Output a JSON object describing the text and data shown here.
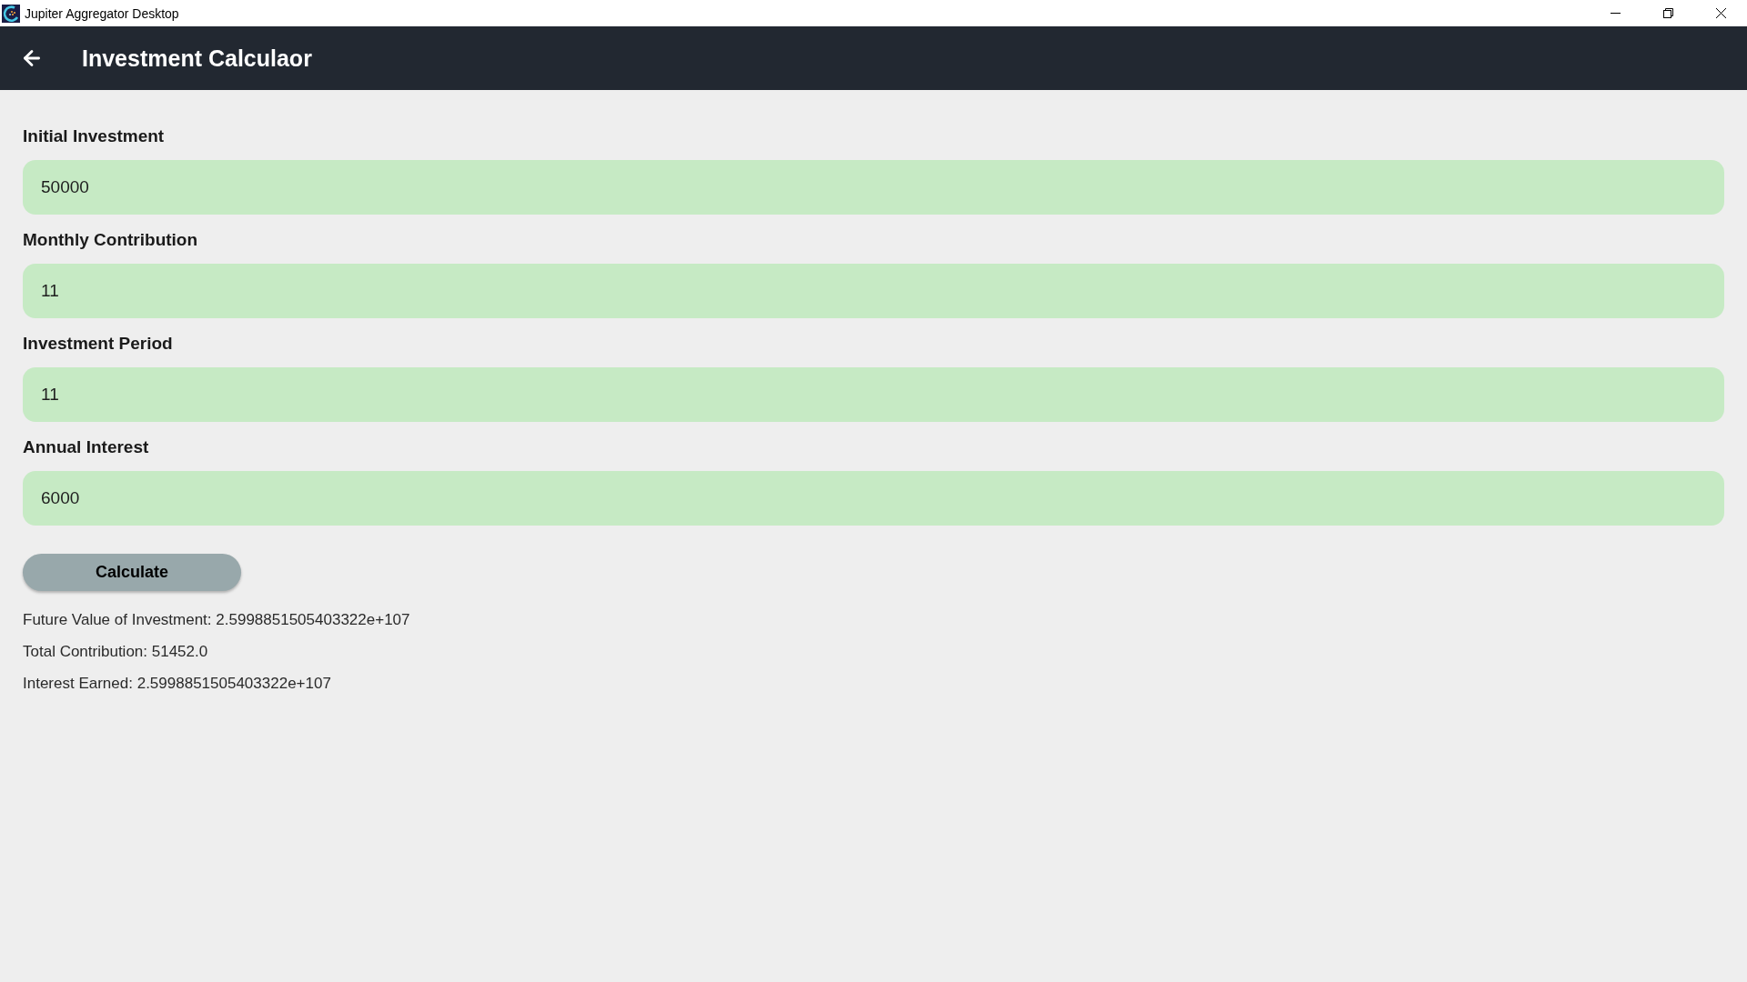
{
  "window": {
    "title": "Jupiter Aggregator Desktop"
  },
  "app_bar": {
    "title": "Investment Calculaor"
  },
  "fields": [
    {
      "label": "Initial Investment",
      "value": "50000"
    },
    {
      "label": "Monthly Contribution",
      "value": "11"
    },
    {
      "label": "Investment Period",
      "value": "11"
    },
    {
      "label": "Annual Interest",
      "value": "6000"
    }
  ],
  "calculate_button": {
    "label": "Calculate"
  },
  "results": [
    "Future Value of Investment: 2.5998851505403322e+107",
    "Total Contribution: 51452.0",
    "Interest Earned: 2.5998851505403322e+107"
  ]
}
